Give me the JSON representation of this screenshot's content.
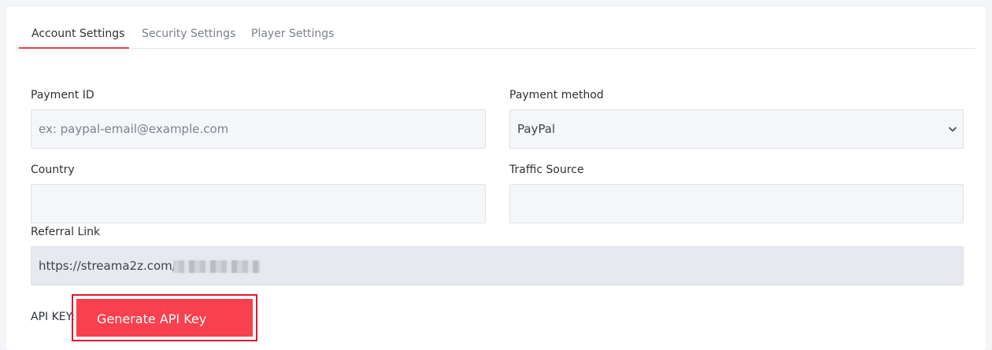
{
  "tabs": [
    {
      "label": "Account Settings",
      "active": true
    },
    {
      "label": "Security Settings",
      "active": false
    },
    {
      "label": "Player Settings",
      "active": false
    }
  ],
  "form": {
    "payment_id": {
      "label": "Payment ID",
      "value": "",
      "placeholder": "ex: paypal-email@example.com"
    },
    "payment_method": {
      "label": "Payment method",
      "selected": "PayPal"
    },
    "country": {
      "label": "Country",
      "value": ""
    },
    "traffic_source": {
      "label": "Traffic Source",
      "value": ""
    },
    "referral_link": {
      "label": "Referral Link",
      "value": "https://streama2z.com/"
    },
    "api_key": {
      "label": "API KEY:",
      "button_label": "Generate API Key"
    }
  },
  "colors": {
    "accent": "#e8414b",
    "button_bg": "#f8404e",
    "highlight_border": "#e3162a"
  }
}
